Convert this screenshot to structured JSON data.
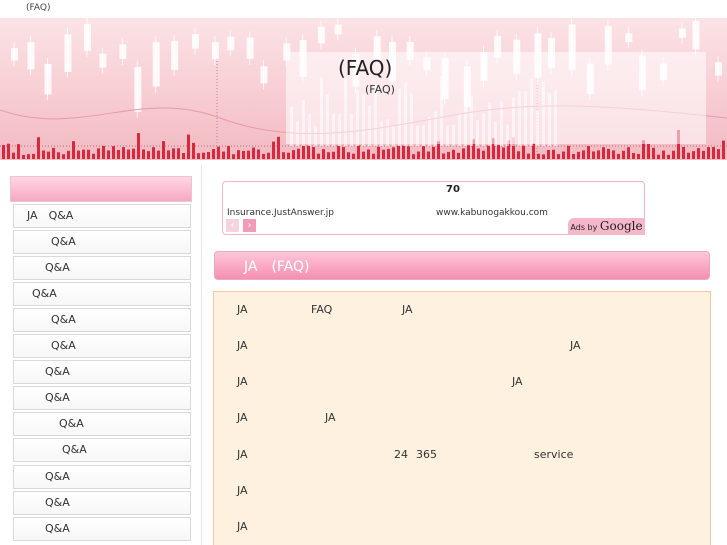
{
  "header": {
    "breadcrumb": "(FAQ)"
  },
  "banner": {
    "title": "(FAQ)",
    "subtitle": "(FAQ)"
  },
  "sidebar": {
    "heading": "",
    "items": [
      {
        "label": "JA　Q&A"
      },
      {
        "label": "Q&A"
      },
      {
        "label": "Q&A"
      },
      {
        "label": "Q&A"
      },
      {
        "label": "Q&A"
      },
      {
        "label": "Q&A"
      },
      {
        "label": "Q&A"
      },
      {
        "label": "Q&A"
      },
      {
        "label": "Q&A"
      },
      {
        "label": "Q&A"
      },
      {
        "label": "Q&A"
      },
      {
        "label": "Q&A"
      },
      {
        "label": "Q&A"
      }
    ]
  },
  "ads": {
    "title": "70",
    "url_left": "Insurance.JustAnswer.jp",
    "url_right": "www.kabunogakkou.com",
    "prev": "‹",
    "next": "›",
    "ads_by": "Ads by",
    "google": "Google"
  },
  "section": {
    "title": "JA　(FAQ)"
  },
  "faq": {
    "rows": [
      [
        "JA",
        "FAQ",
        "JA"
      ],
      [
        "JA",
        "JA"
      ],
      [
        "JA",
        "JA"
      ],
      [
        "JA",
        "JA"
      ],
      [
        "JA",
        "24",
        "365",
        "service"
      ],
      [
        "JA"
      ],
      [
        "JA"
      ]
    ]
  }
}
